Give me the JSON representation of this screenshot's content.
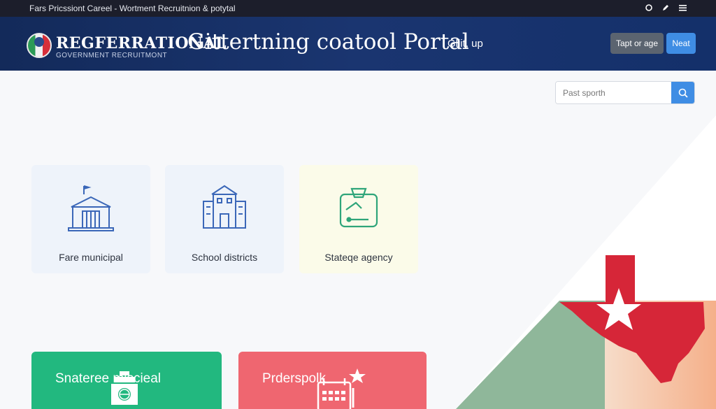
{
  "topbar": {
    "title": "Fars Pricssiont Careel - Wortment Recruitnion & potytal"
  },
  "header": {
    "brand": "REGFERRATIONAL",
    "portal": "Gittertning coatool Portal",
    "subtitle": "GOVERNMENT RECRUITMONT",
    "link": "Gliit, up",
    "btn_primary": "Tapt or age",
    "btn_secondary": "Neat"
  },
  "search": {
    "placeholder": "Past sporth"
  },
  "categories": [
    {
      "label": "Fare municipal",
      "icon": "city-hall-icon"
    },
    {
      "label": "School districts",
      "icon": "school-building-icon"
    },
    {
      "label": "Stateqe agency",
      "icon": "agency-badge-icon"
    }
  ],
  "featured": [
    {
      "label": "Snateree    miscieal",
      "icon": "capitol-globe-icon"
    },
    {
      "label": "Prderspolk",
      "icon": "calendar-star-icon"
    }
  ],
  "colors": {
    "header": "#132a5a",
    "accent": "#3f8de4",
    "green": "#22b87f",
    "red": "#ef6670"
  }
}
